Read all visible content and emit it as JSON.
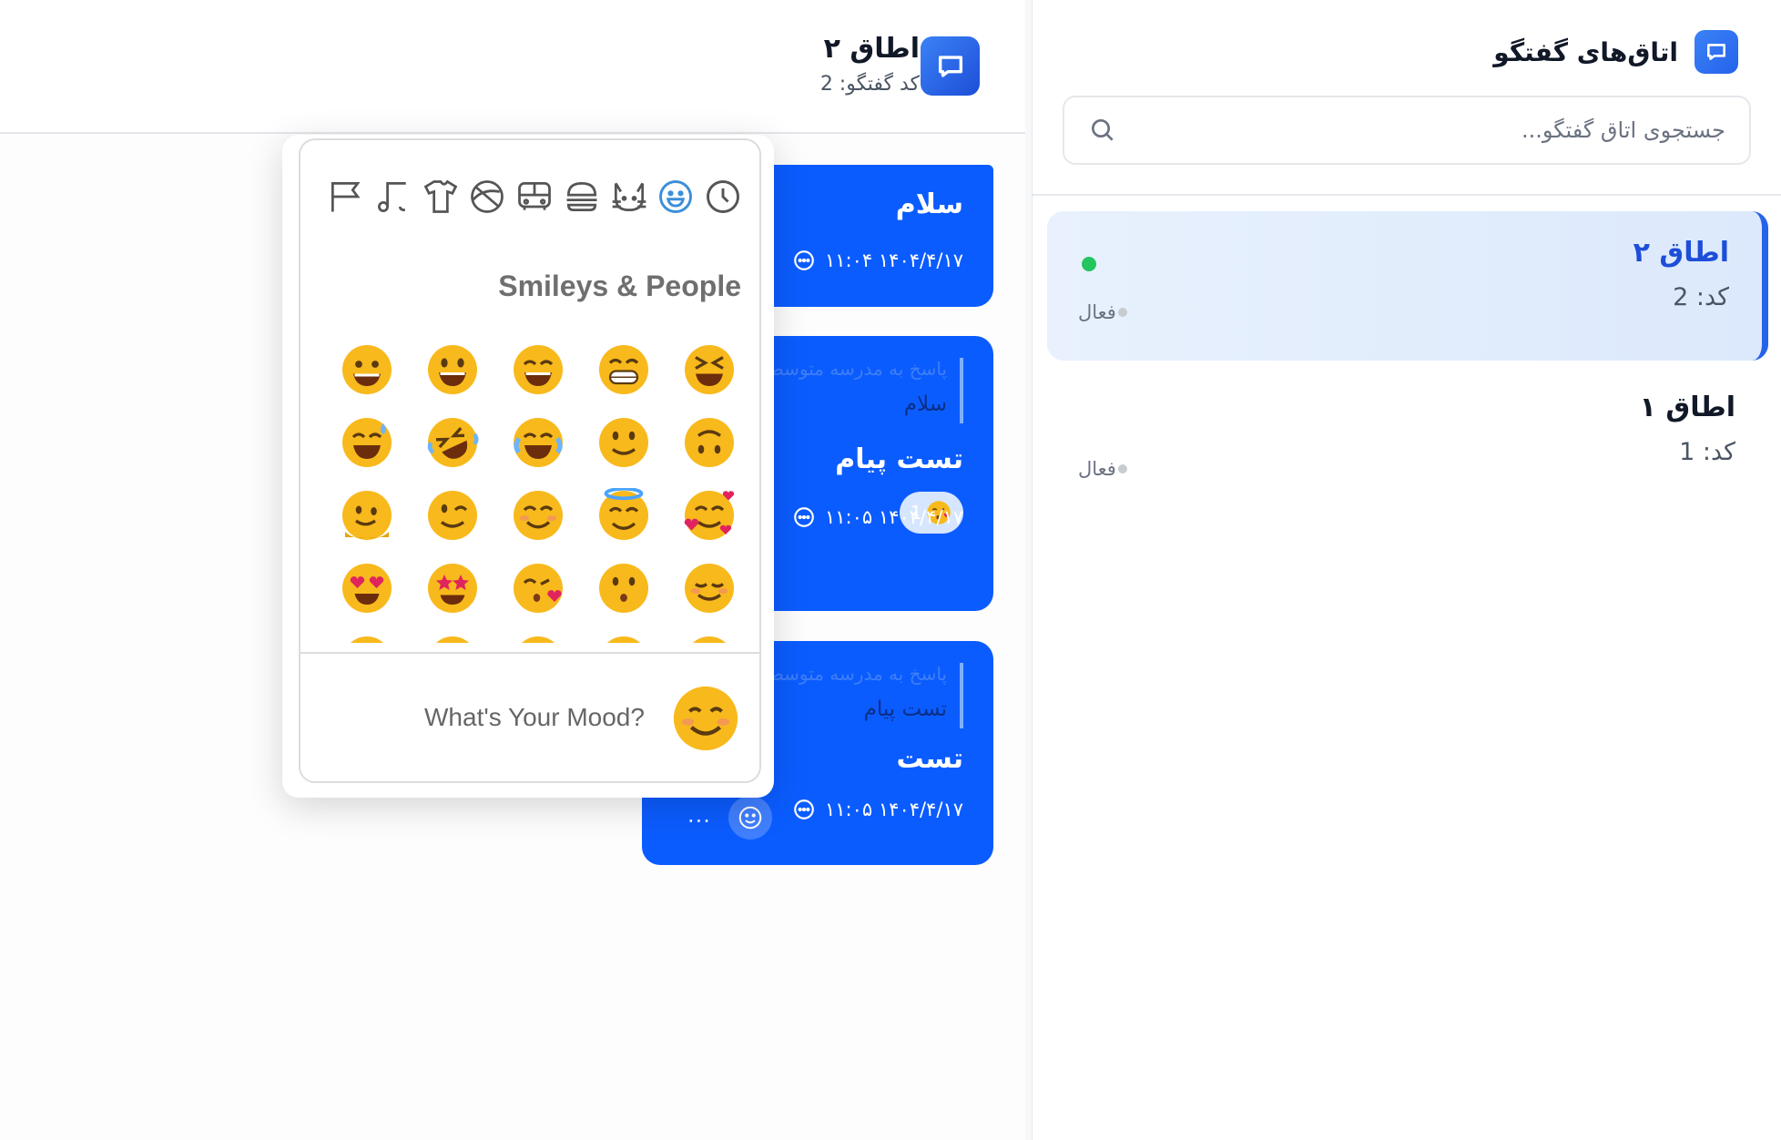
{
  "sidebar": {
    "title": "اتاق‌های گفتگو",
    "search_placeholder": "جستجوی اتاق گفتگو...",
    "rooms": [
      {
        "name": "اطاق ۲",
        "code": "کد: 2",
        "status": "فعال",
        "online": true,
        "active": true
      },
      {
        "name": "اطاق ۱",
        "code": "کد: 1",
        "status": "فعال",
        "online": false,
        "active": false
      }
    ]
  },
  "chat": {
    "title": "اطاق ۲",
    "subtitle": "کد گفتگو: 2",
    "messages": [
      {
        "text": "سلام",
        "time": "۱۴۰۴/۴/۱۷ ۱۱:۰۴"
      },
      {
        "reply_from": "پاسخ به مدرسه متوسطه",
        "reply_text": "سلام",
        "text": "تست پیام",
        "reaction_count": "1",
        "time": "۱۴۰۴/۴/۱۷ ۱۱:۰۵"
      },
      {
        "reply_from": "پاسخ به مدرسه متوسطه",
        "reply_text": "تست پیام",
        "text": "تست",
        "time": "۱۴۰۴/۴/۱۷ ۱۱:۰۵",
        "more": "···"
      }
    ]
  },
  "emoji_picker": {
    "categories": [
      "recent-icon",
      "smileys-icon",
      "animals-icon",
      "food-icon",
      "travel-icon",
      "activities-icon",
      "objects-icon",
      "symbols-icon",
      "flags-icon"
    ],
    "active_category": "smileys-icon",
    "section_title": "Smileys & People",
    "footer_text": "What's Your Mood?",
    "emojis": [
      "grinning",
      "smiley",
      "smile",
      "grin",
      "laughing",
      "sweat-smile",
      "rofl",
      "joy",
      "slightly-smiling",
      "upside-down",
      "melting",
      "wink",
      "blush",
      "innocent",
      "smiling-hearts",
      "heart-eyes",
      "star-struck",
      "kissing-heart",
      "kissing",
      "relaxed",
      "grinning",
      "smiley",
      "smile",
      "grin",
      "laughing"
    ]
  },
  "colors": {
    "accent": "#0b5cff",
    "active_room_bg": "#e5effd",
    "online": "#22c55e",
    "emoji_yellow": "#f8b91c"
  }
}
